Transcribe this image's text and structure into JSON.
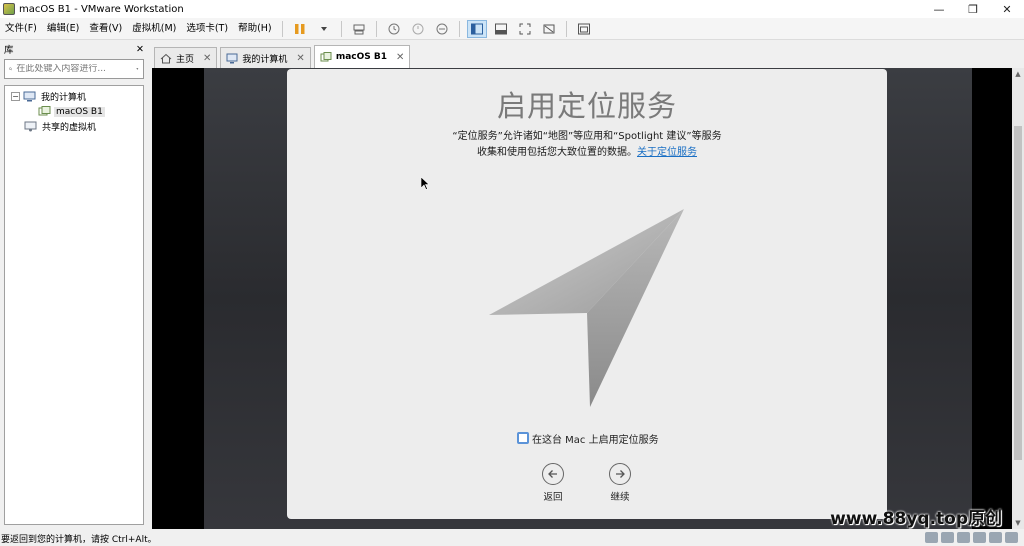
{
  "window": {
    "title": "macOS B1 - VMware Workstation",
    "controls": [
      "—",
      "❐",
      "✕"
    ]
  },
  "menu": {
    "items": [
      "文件(F)",
      "编辑(E)",
      "查看(V)",
      "虚拟机(M)",
      "选项卡(T)",
      "帮助(H)"
    ]
  },
  "library": {
    "title": "库",
    "close": "✕",
    "search_placeholder": "在此处键入内容进行...",
    "tree": {
      "my_computer": "我的计算机",
      "vm": "macOS B1",
      "shared": "共享的虚拟机"
    }
  },
  "tabs": [
    {
      "label": "主页",
      "close": "✕"
    },
    {
      "label": "我的计算机",
      "close": "✕"
    },
    {
      "label": "macOS B1",
      "close": "✕"
    }
  ],
  "setup": {
    "title": "启用定位服务",
    "desc_line1": "“定位服务”允许诸如“地图”等应用和“Spotlight 建议”等服务",
    "desc_line2": "收集和使用包括您大致位置的数据。",
    "link": "关于定位服务",
    "checkbox_label": "在这台 Mac 上启用定位服务",
    "back_label": "返回",
    "continue_label": "继续"
  },
  "statusbar": {
    "text": "要返回到您的计算机，请按 Ctrl+Alt。"
  },
  "watermark": "www.88yq.top原创",
  "colors": {
    "link": "#1a6fc4",
    "checkbox_border": "#5b93d8",
    "toolbar_active": "#cce4f7"
  }
}
